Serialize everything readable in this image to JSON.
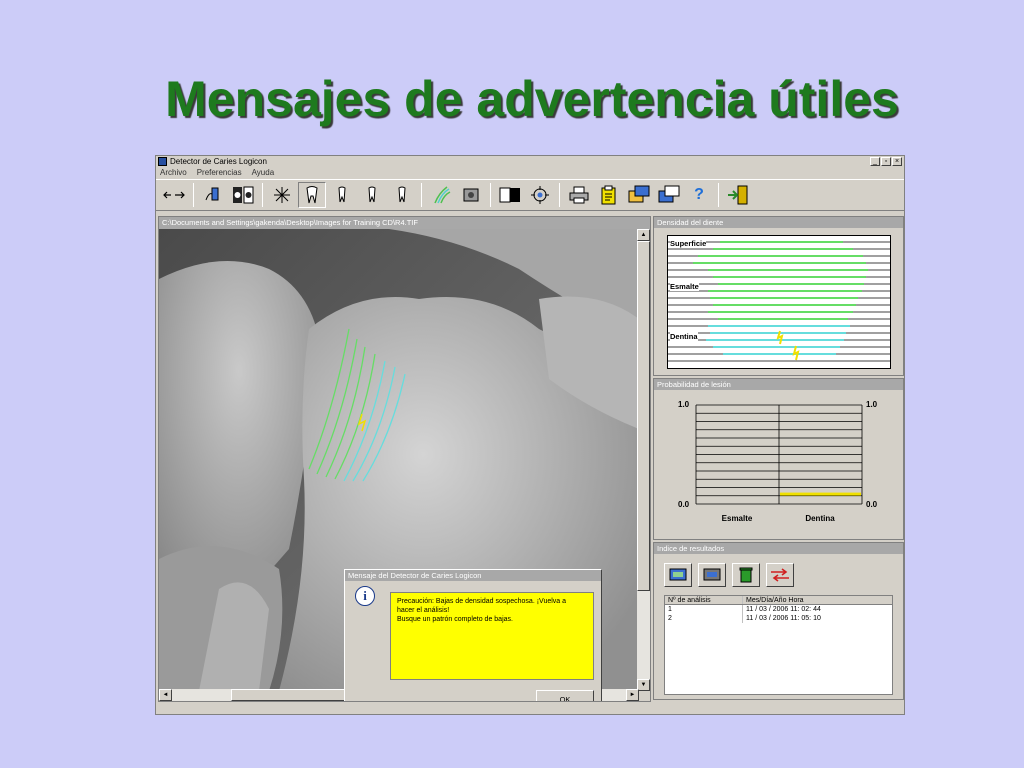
{
  "slide": {
    "title": "Mensajes de advertencia útiles"
  },
  "window": {
    "title": "Detector de Caries Logicon",
    "controls": {
      "minimize": "_",
      "maximize": "▫",
      "close": "×"
    }
  },
  "menu": [
    "Archivo",
    "Preferencias",
    "Ayuda"
  ],
  "toolbar": {
    "buttons": [
      "rotate-tool-icon",
      "pointer-tool-icon",
      "compare-tool-icon",
      "contrast-tool-icon",
      "tooth-outline-icon",
      "tooth-select-1-icon",
      "tooth-select-2-icon",
      "tooth-select-3-icon",
      "scan-lines-icon",
      "enhance-icon",
      "invert-icon",
      "target-icon",
      "print-icon",
      "report-icon",
      "export-icon",
      "export-2-icon",
      "help-icon",
      "exit-icon"
    ],
    "help_glyph": "?"
  },
  "image_pane": {
    "path": "C:\\Documents and Settings\\gakenda\\Desktop\\Images for Training CD\\R4.TIF"
  },
  "dialog": {
    "title": "Mensaje del Detector de Caries Logicon",
    "icon_glyph": "i",
    "message_lines": [
      "Precaución: Bajas de densidad sospechosa. ¡Vuelva a",
      "hacer el análisis!",
      "Busque un patrón completo de bajas."
    ],
    "ok_label": "OK"
  },
  "density_panel": {
    "title": "Densidad del diente",
    "labels": {
      "surface": "Superficie",
      "enamel": "Esmalte",
      "dentin": "Dentina"
    },
    "colors": {
      "enamel": "#66dd66",
      "dentin": "#66dddd",
      "marker": "#f0e000"
    }
  },
  "probability_panel": {
    "title": "Probabilidad de lesión",
    "left_max": "1.0",
    "left_min": "0.0",
    "right_max": "1.0",
    "right_min": "0.0",
    "categories": [
      "Esmalte",
      "Dentina"
    ],
    "values": {
      "Esmalte": 0.0,
      "Dentina": 0.1
    },
    "bar_color": "#f0e000"
  },
  "results_panel": {
    "title": "Indice de resultados",
    "buttons": [
      "open-analysis-icon",
      "save-analysis-icon",
      "delete-analysis-icon",
      "compare-analysis-icon"
    ],
    "columns": [
      "Nº de análisis",
      "Mes/Día/Año  Hora"
    ],
    "rows": [
      {
        "num": "1",
        "datetime": "11 / 03 / 2006   11: 02: 44"
      },
      {
        "num": "2",
        "datetime": "11 / 03 / 2006   11: 05: 10"
      }
    ]
  },
  "scrollbars": {
    "up": "▲",
    "down": "▼",
    "left": "◄",
    "right": "►"
  }
}
